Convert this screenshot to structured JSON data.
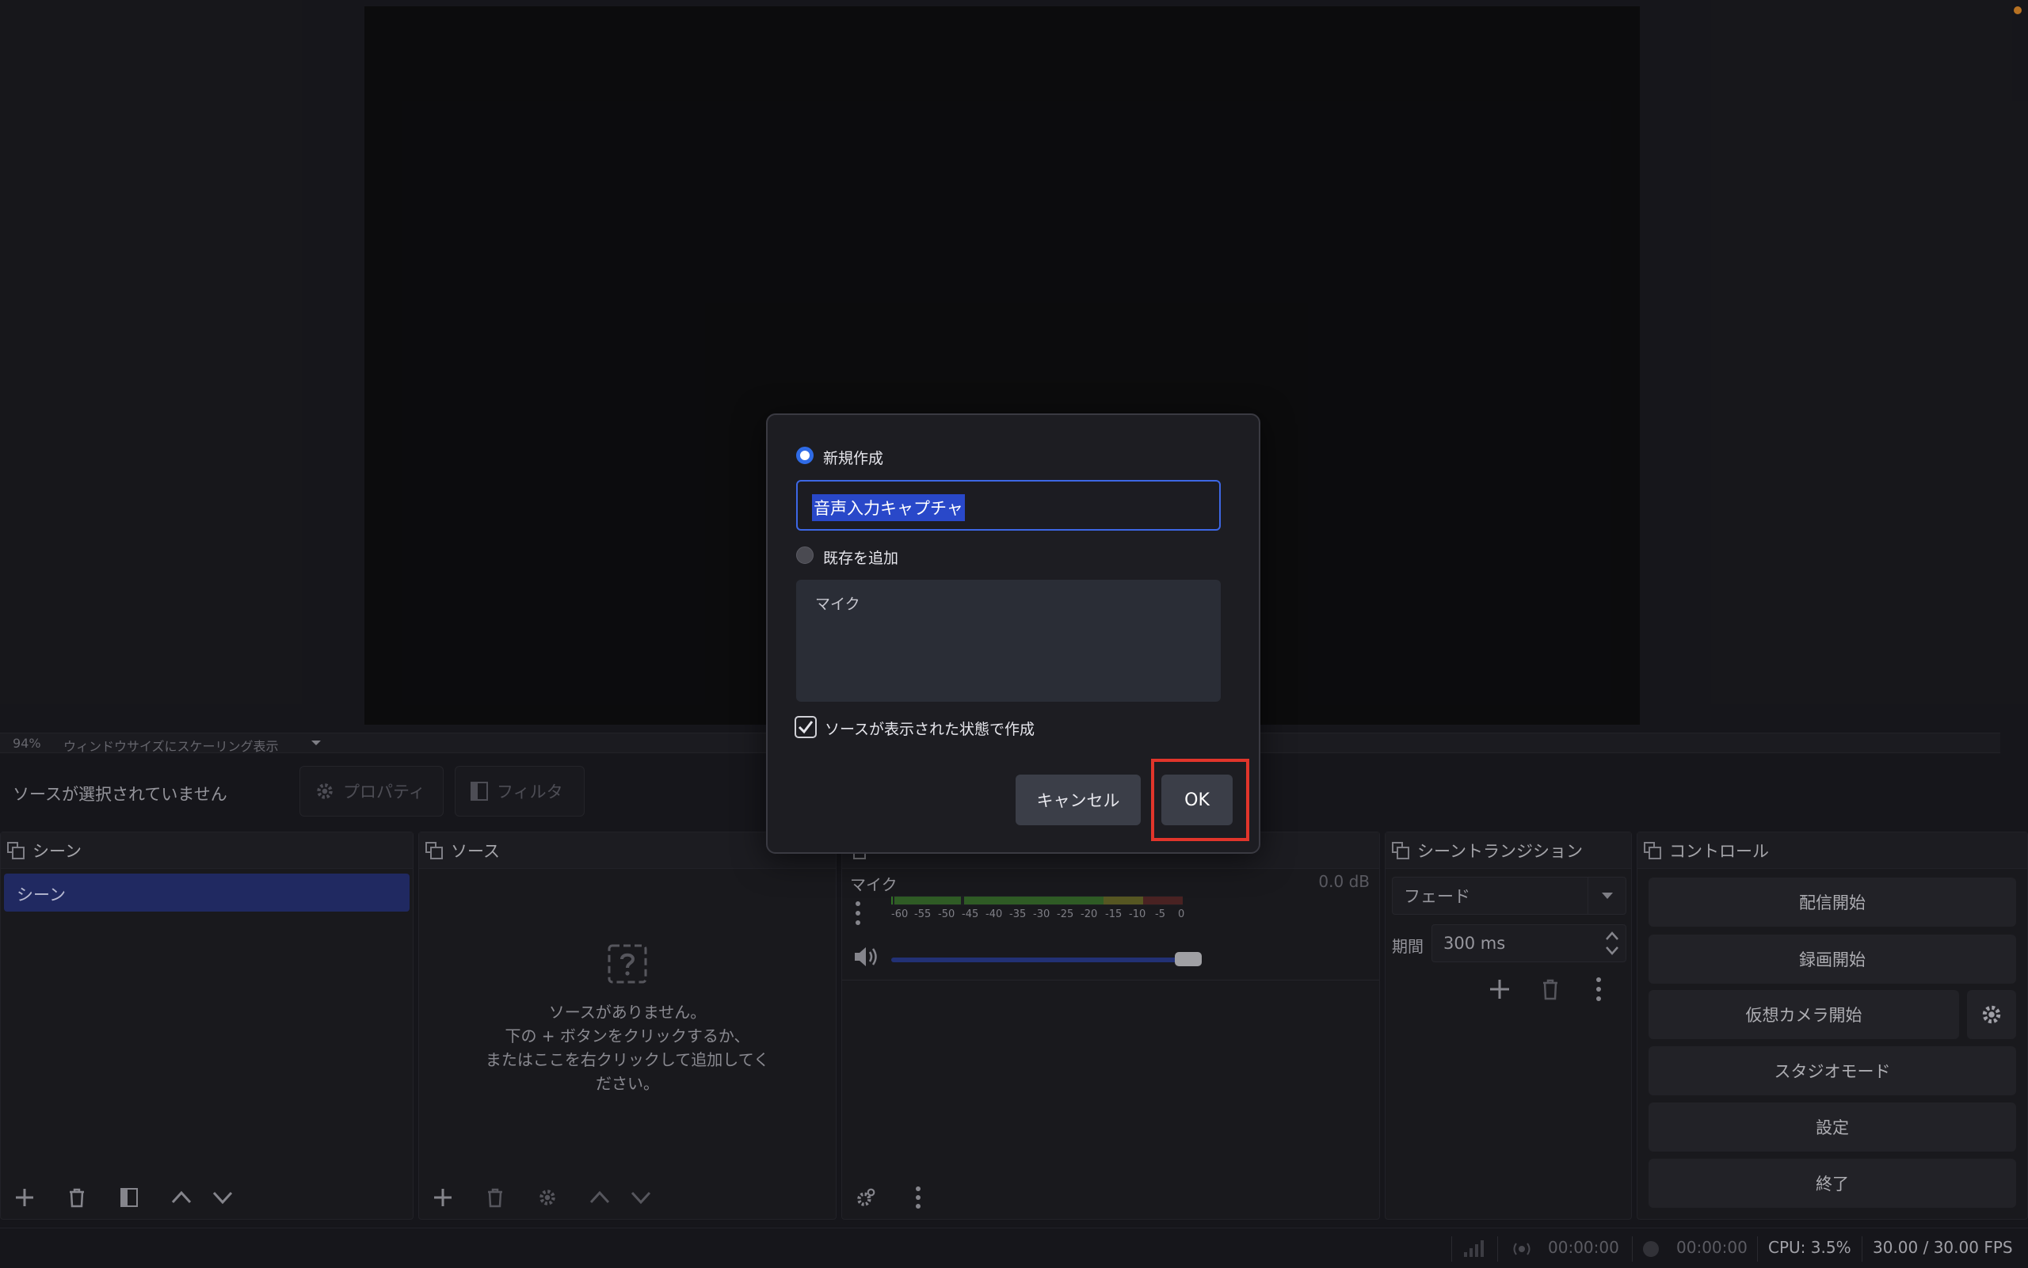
{
  "preview": {
    "corner_dot_color": "#e08a2a"
  },
  "zoom_bar": {
    "zoom": "94%",
    "scale_mode": "ウィンドウサイズにスケーリング表示"
  },
  "context_bar": {
    "no_source_selected": "ソースが選択されていません",
    "properties_label": "プロパティ",
    "filters_label": "フィルタ"
  },
  "scenes_dock": {
    "title": "シーン",
    "items": [
      "シーン"
    ]
  },
  "sources_dock": {
    "title": "ソース",
    "empty_line1": "ソースがありません。",
    "empty_line2": "下の + ボタンをクリックするか、",
    "empty_line3": "またはここを右クリックして追加してく",
    "empty_line4": "ださい。"
  },
  "audio_mixer": {
    "channel_name": "マイク",
    "level": "0.0 dB",
    "ticks": [
      "-60",
      "-55",
      "-50",
      "-45",
      "-40",
      "-35",
      "-30",
      "-25",
      "-20",
      "-15",
      "-10",
      "-5",
      "0"
    ]
  },
  "transitions_dock": {
    "title": "シーントランジション",
    "selected": "フェード",
    "duration_label": "期間",
    "duration_value": "300 ms"
  },
  "controls_dock": {
    "title": "コントロール",
    "start_streaming": "配信開始",
    "start_recording": "録画開始",
    "start_virtual_camera": "仮想カメラ開始",
    "studio_mode": "スタジオモード",
    "settings": "設定",
    "exit": "終了"
  },
  "status_bar": {
    "stream_time": "00:00:00",
    "record_time": "00:00:00",
    "cpu": "CPU: 3.5%",
    "fps": "30.00 / 30.00 FPS"
  },
  "dialog": {
    "create_new_label": "新規作成",
    "name_value": "音声入力キャプチャ",
    "add_existing_label": "既存を追加",
    "existing_sources": [
      "マイク"
    ],
    "make_visible_label": "ソースが表示された状態で作成",
    "make_visible_checked": true,
    "cancel_label": "キャンセル",
    "ok_label": "OK",
    "accent_color": "#3d67e5",
    "highlight_color": "#e1352b"
  }
}
